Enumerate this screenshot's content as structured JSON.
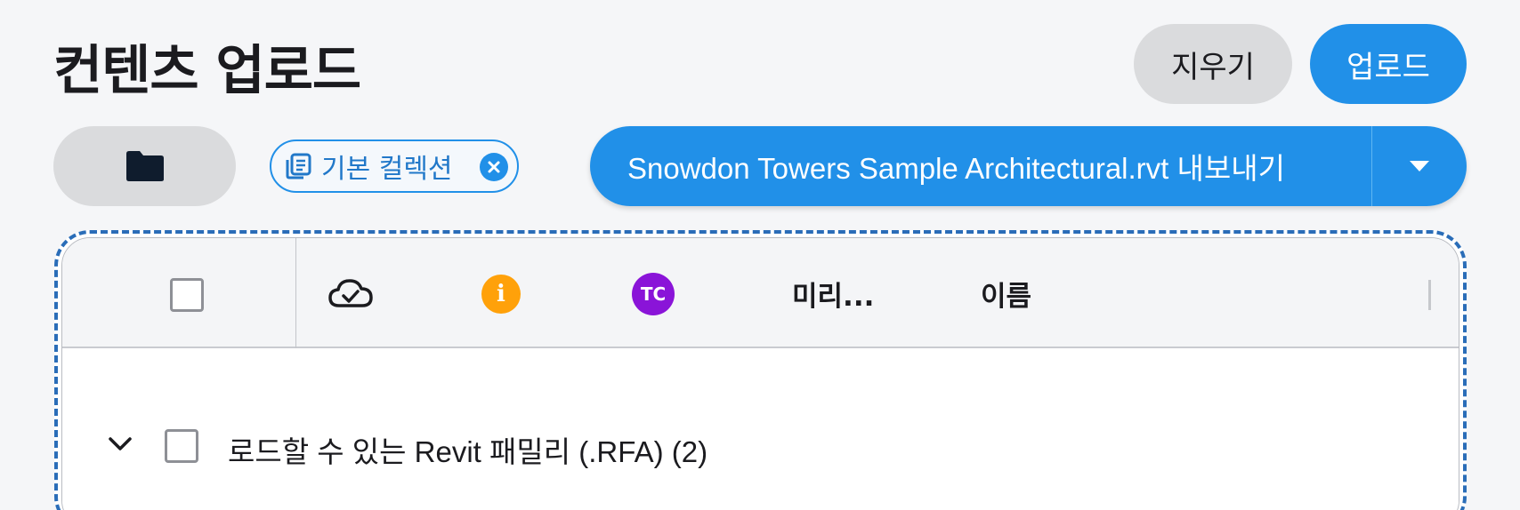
{
  "header": {
    "title": "컨텐츠 업로드",
    "clear_label": "지우기",
    "upload_label": "업로드"
  },
  "toolbar": {
    "folder_icon": "folder-icon",
    "collection_chip": {
      "label": "기본 컬렉션",
      "icon": "collection-icon",
      "close_icon": "close-icon"
    },
    "export_button": {
      "label": "Snowdon Towers Sample Architectural.rvt 내보내기",
      "caret_icon": "caret-down-icon"
    }
  },
  "table": {
    "headers": {
      "cloud_icon": "cloud-check-icon",
      "info_icon_text": "i",
      "tc_badge": "TC",
      "preview": "미리...",
      "name": "이름"
    },
    "groups": [
      {
        "label": "로드할 수 있는 Revit 패밀리 (.RFA) (2)",
        "expanded": true
      }
    ]
  },
  "colors": {
    "accent": "#2190e8",
    "neutral_button": "#dadbdd",
    "info": "#ffa10a",
    "tc_badge": "#8a14d8",
    "dropzone_border": "#2a6db8"
  }
}
